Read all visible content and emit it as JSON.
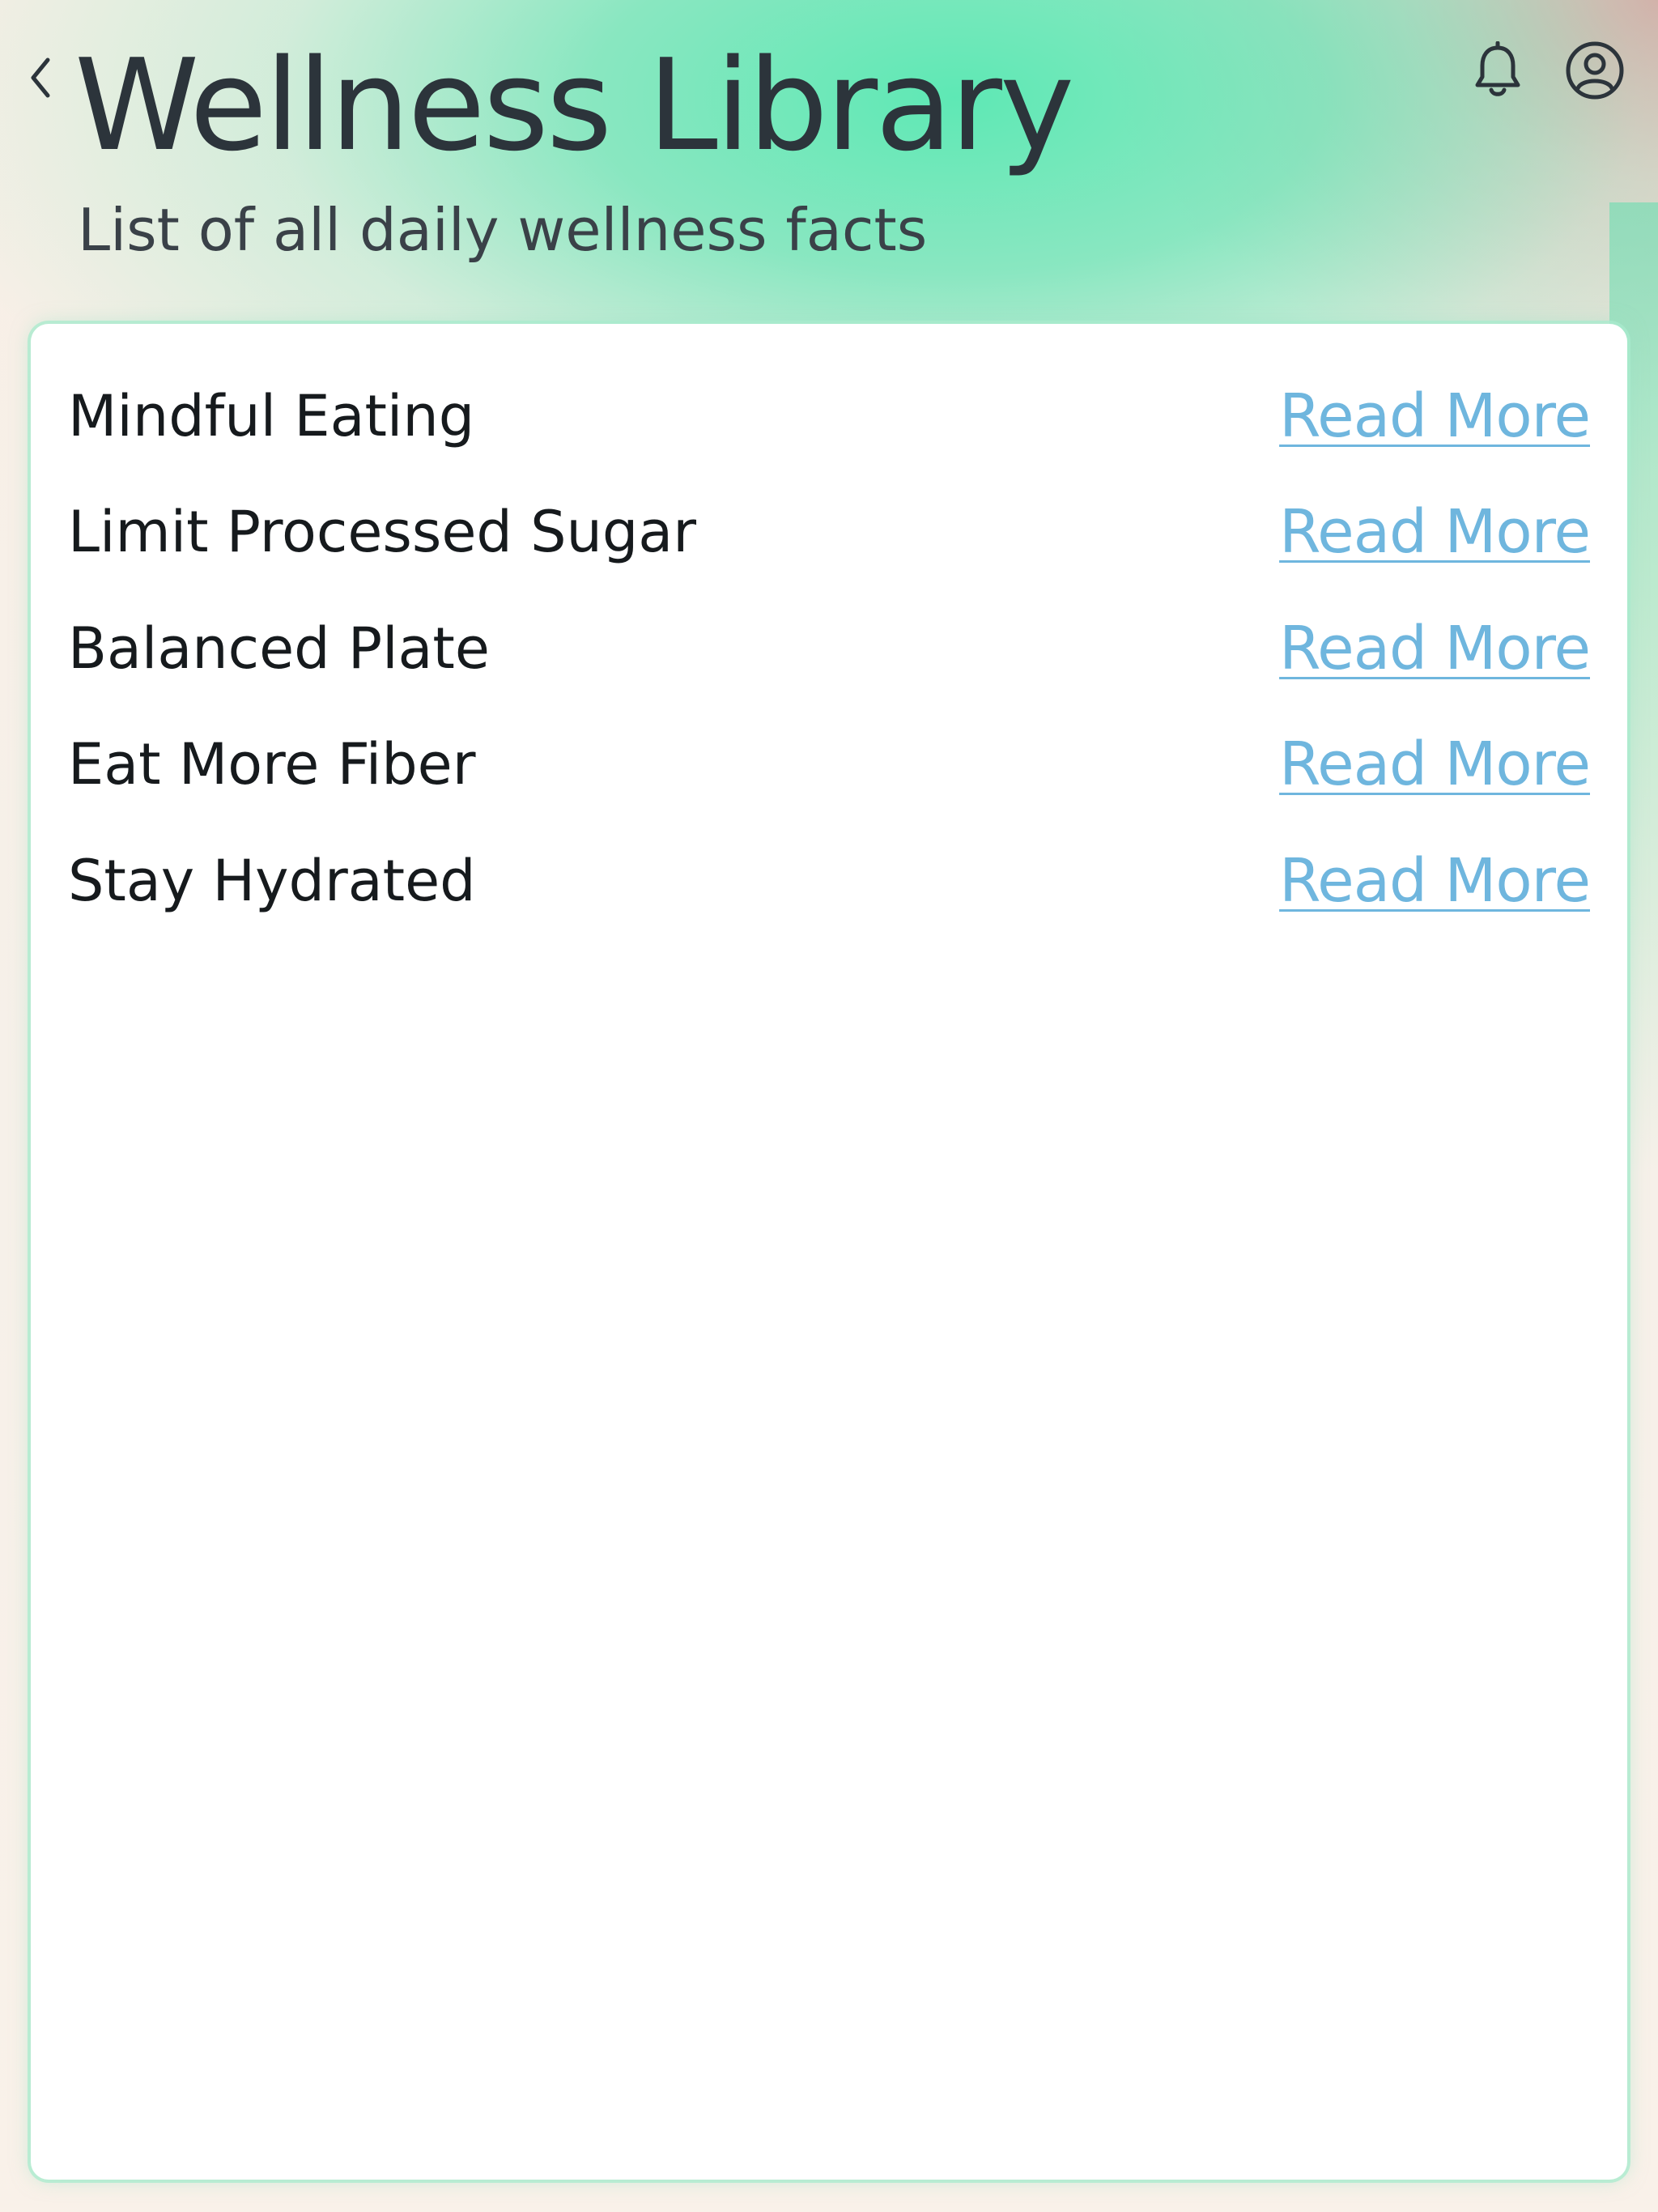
{
  "header": {
    "title": "Wellness Library",
    "subtitle": "List of all daily wellness facts",
    "back_icon": "chevron-left-icon",
    "notification_icon": "bell-icon",
    "profile_icon": "user-circle-icon"
  },
  "colors": {
    "accent_link": "#6fb6de",
    "title_text": "#2c343b",
    "gradient_green": "#56e8b2",
    "gradient_pink": "#f0969b"
  },
  "library": {
    "items": [
      {
        "title": "Mindful Eating",
        "link_label": "Read More"
      },
      {
        "title": "Limit Processed Sugar",
        "link_label": "Read More"
      },
      {
        "title": "Balanced Plate",
        "link_label": "Read More"
      },
      {
        "title": "Eat More Fiber",
        "link_label": "Read More"
      },
      {
        "title": "Stay Hydrated",
        "link_label": "Read More"
      }
    ]
  }
}
